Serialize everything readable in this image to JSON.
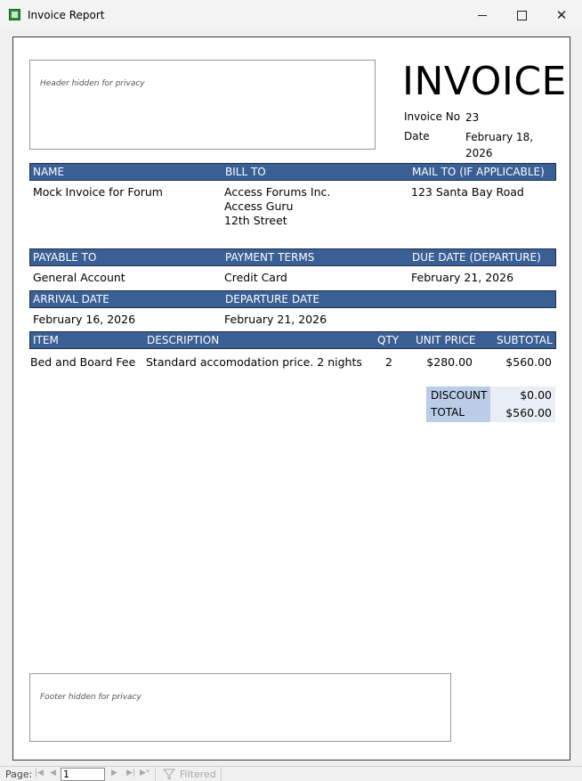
{
  "window": {
    "title": "Invoice Report",
    "minimize": "—",
    "maximize": "□",
    "close": "✕"
  },
  "report": {
    "header_note": "Header hidden for privacy",
    "footer_note": "Footer hidden for privacy",
    "title": "INVOICE",
    "invoice_no_label": "Invoice No",
    "invoice_no": "23",
    "date_label": "Date",
    "date_value": "February 18, 2026",
    "band1": {
      "name": "NAME",
      "bill_to": "BILL TO",
      "mail_to": "MAIL TO (IF APPLICABLE)"
    },
    "name_value": "Mock Invoice for Forum",
    "bill_to_lines": [
      "Access Forums Inc.",
      "Access Guru",
      "12th Street"
    ],
    "mail_to_value": "123 Santa Bay Road",
    "band2": {
      "payable_to": "PAYABLE TO",
      "payment_terms": "PAYMENT TERMS",
      "due_date": "DUE DATE (DEPARTURE)"
    },
    "payable_to_value": "General Account",
    "payment_terms_value": "Credit Card",
    "due_date_value": "February 21, 2026",
    "band3": {
      "arrival": "ARRIVAL DATE",
      "departure": "DEPARTURE DATE"
    },
    "arrival_value": "February 16, 2026",
    "departure_value": "February 21, 2026",
    "items_header": {
      "item": "ITEM",
      "description": "DESCRIPTION",
      "qty": "QTY",
      "unit_price": "UNIT PRICE",
      "subtotal": "SUBTOTAL"
    },
    "items": [
      {
        "item": "Bed and Board Fee",
        "description": "Standard accomodation price. 2 nights",
        "qty": "2",
        "unit_price": "$280.00",
        "subtotal": "$560.00"
      }
    ],
    "totals": {
      "discount_label": "DISCOUNT",
      "discount_value": "$0.00",
      "total_label": "TOTAL",
      "total_value": "$560.00"
    }
  },
  "navbar": {
    "page_label": "Page:",
    "page_value": "1",
    "first": "|◀",
    "prev": "◀",
    "next": "▶",
    "last": "▶|",
    "new": "▶*",
    "filter_label": "Filtered"
  }
}
